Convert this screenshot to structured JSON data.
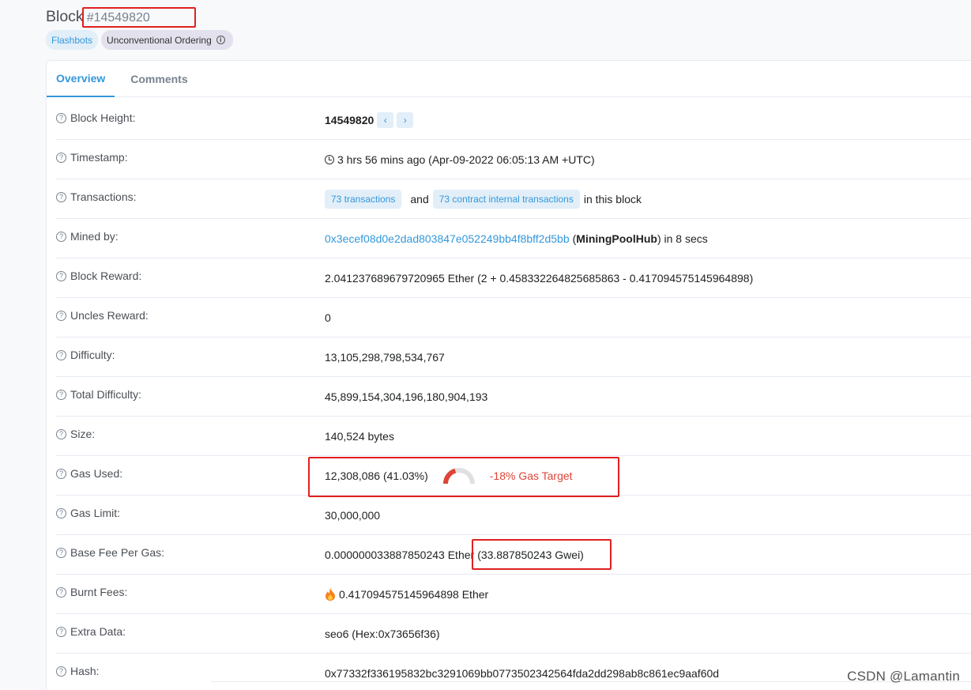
{
  "header": {
    "title": "Block",
    "block_number": "#14549820"
  },
  "badges": {
    "flashbots": "Flashbots",
    "unconventional": "Unconventional Ordering"
  },
  "tabs": {
    "overview": "Overview",
    "comments": "Comments"
  },
  "rows": {
    "block_height": {
      "label": "Block Height:",
      "value": "14549820",
      "prev": "‹",
      "next": "›"
    },
    "timestamp": {
      "label": "Timestamp:",
      "value": "3 hrs 56 mins ago (Apr-09-2022 06:05:13 AM +UTC)"
    },
    "transactions": {
      "label": "Transactions:",
      "tx_link": "73 transactions",
      "and": "and",
      "internal_link": "73 contract internal transactions",
      "suffix": "in this block"
    },
    "mined_by": {
      "label": "Mined by:",
      "address": "0x3ecef08d0e2dad803847e052249bb4f8bff2d5bb",
      "open": "(",
      "pool": "MiningPoolHub",
      "suffix": ") in 8 secs"
    },
    "block_reward": {
      "label": "Block Reward:",
      "value": "2.041237689679720965 Ether (2 + 0.458332264825685863 - 0.417094575145964898)"
    },
    "uncles_reward": {
      "label": "Uncles Reward:",
      "value": "0"
    },
    "difficulty": {
      "label": "Difficulty:",
      "value": "13,105,298,798,534,767"
    },
    "total_difficulty": {
      "label": "Total Difficulty:",
      "value": "45,899,154,304,196,180,904,193"
    },
    "size": {
      "label": "Size:",
      "value": "140,524 bytes"
    },
    "gas_used": {
      "label": "Gas Used:",
      "value": "12,308,086 (41.03%)",
      "gauge_fraction": 0.4103,
      "target": "-18% Gas Target"
    },
    "gas_limit": {
      "label": "Gas Limit:",
      "value": "30,000,000"
    },
    "base_fee": {
      "label": "Base Fee Per Gas:",
      "value": "0.000000033887850243 Ether",
      "gwei": "(33.887850243 Gwei)"
    },
    "burnt_fees": {
      "label": "Burnt Fees:",
      "value": "0.417094575145964898 Ether"
    },
    "extra_data": {
      "label": "Extra Data:",
      "value": "seo6 (Hex:0x73656f36)"
    },
    "hash": {
      "label": "Hash:",
      "value": "0x77332f336195832bc3291069bb0773502342564fda2dd298ab8c861ec9aaf60d"
    }
  },
  "watermark": "CSDN @Lamantin",
  "colors": {
    "accent": "#3498db",
    "danger": "#de4437",
    "highlight": "#e02020"
  }
}
